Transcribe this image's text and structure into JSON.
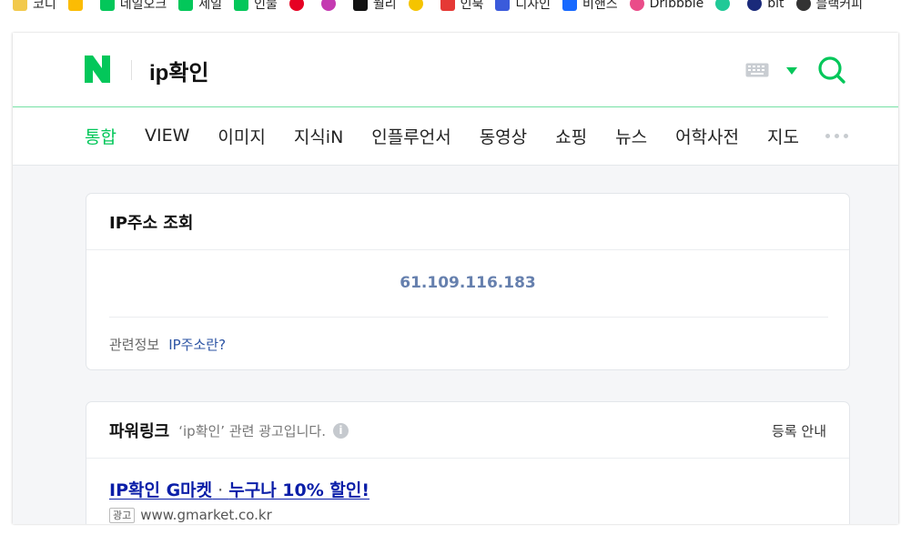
{
  "bookmarks": [
    {
      "label": "코디",
      "icon": "bookmark-icon",
      "color": "#f2c94c"
    },
    {
      "label": "",
      "icon": "google-drive-icon",
      "color": "#fbbc04"
    },
    {
      "label": "네일오크",
      "icon": "naver-cafe-icon",
      "color": "#03c75a"
    },
    {
      "label": "세일",
      "icon": "naver-cafe-icon",
      "color": "#03c75a"
    },
    {
      "label": "인물",
      "icon": "mail-icon",
      "color": "#03c75a"
    },
    {
      "label": "",
      "icon": "pinterest-icon",
      "color": "#e60023"
    },
    {
      "label": "",
      "icon": "dots-app-icon",
      "color": "#c43ab1"
    },
    {
      "label": "월리",
      "icon": "tiktok-icon",
      "color": "#111111"
    },
    {
      "label": "",
      "icon": "kakao-icon",
      "color": "#f5c400"
    },
    {
      "label": "인북",
      "icon": "music-icon",
      "color": "#e53935"
    },
    {
      "label": "디자인",
      "icon": "arrow-app-icon",
      "color": "#3b5bdb"
    },
    {
      "label": "비핸스",
      "icon": "behance-icon",
      "color": "#1769ff"
    },
    {
      "label": "Dribbble",
      "icon": "dribbble-icon",
      "color": "#ea4c89"
    },
    {
      "label": "",
      "icon": "m-app-icon",
      "color": "#20c997"
    },
    {
      "label": "bit",
      "icon": "hp-icon",
      "color": "#1a2a7a"
    },
    {
      "label": "블랙커피",
      "icon": "record-icon",
      "color": "#333333"
    }
  ],
  "header": {
    "logo_letter": "N",
    "query": "ip확인"
  },
  "tabs": [
    {
      "label": "통합",
      "active": true
    },
    {
      "label": "VIEW",
      "active": false
    },
    {
      "label": "이미지",
      "active": false
    },
    {
      "label": "지식iN",
      "active": false
    },
    {
      "label": "인플루언서",
      "active": false
    },
    {
      "label": "동영상",
      "active": false
    },
    {
      "label": "쇼핑",
      "active": false
    },
    {
      "label": "뉴스",
      "active": false
    },
    {
      "label": "어학사전",
      "active": false
    },
    {
      "label": "지도",
      "active": false
    }
  ],
  "ip_card": {
    "title": "IP주소 조회",
    "ip": "61.109.116.183",
    "related_label": "관련정보",
    "related_link": "IP주소란?"
  },
  "powerlink": {
    "title": "파워링크",
    "desc": "‘ip확인’ 관련 광고입니다.",
    "info": "i",
    "register": "등록 안내",
    "ad_title_1": "IP확인 G마켓",
    "ad_title_sep": " · ",
    "ad_title_2": "누구나 10% 할인!",
    "ad_badge": "광고",
    "ad_url": "www.gmarket.co.kr"
  },
  "colors": {
    "brand_green": "#03c75a",
    "ip_text": "#6680ae",
    "link_blue": "#2b53a3",
    "ad_title": "#0a1ea8"
  }
}
